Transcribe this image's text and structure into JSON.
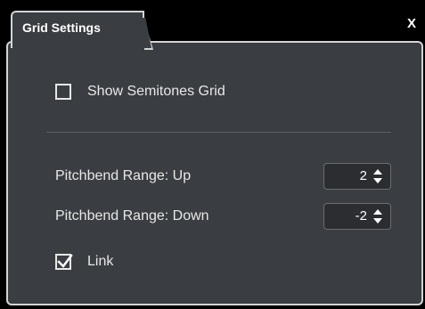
{
  "dialog": {
    "tab_title": "Grid Settings",
    "close_label": "X"
  },
  "options": {
    "show_semitones_grid": {
      "label": "Show Semitones Grid",
      "checked": false
    },
    "link": {
      "label": "Link",
      "checked": true
    }
  },
  "pitchbend": {
    "up": {
      "label": "Pitchbend Range: Up",
      "value": "2"
    },
    "down": {
      "label": "Pitchbend Range: Down",
      "value": "-2"
    }
  },
  "icons": {
    "close": "close-icon",
    "checkmark": "checkmark-icon",
    "spin": "spin-arrows-icon"
  },
  "colors": {
    "background": "#000000",
    "panel": "#3a3d41",
    "border": "#d4d4d4",
    "text": "#e8e8e8"
  }
}
